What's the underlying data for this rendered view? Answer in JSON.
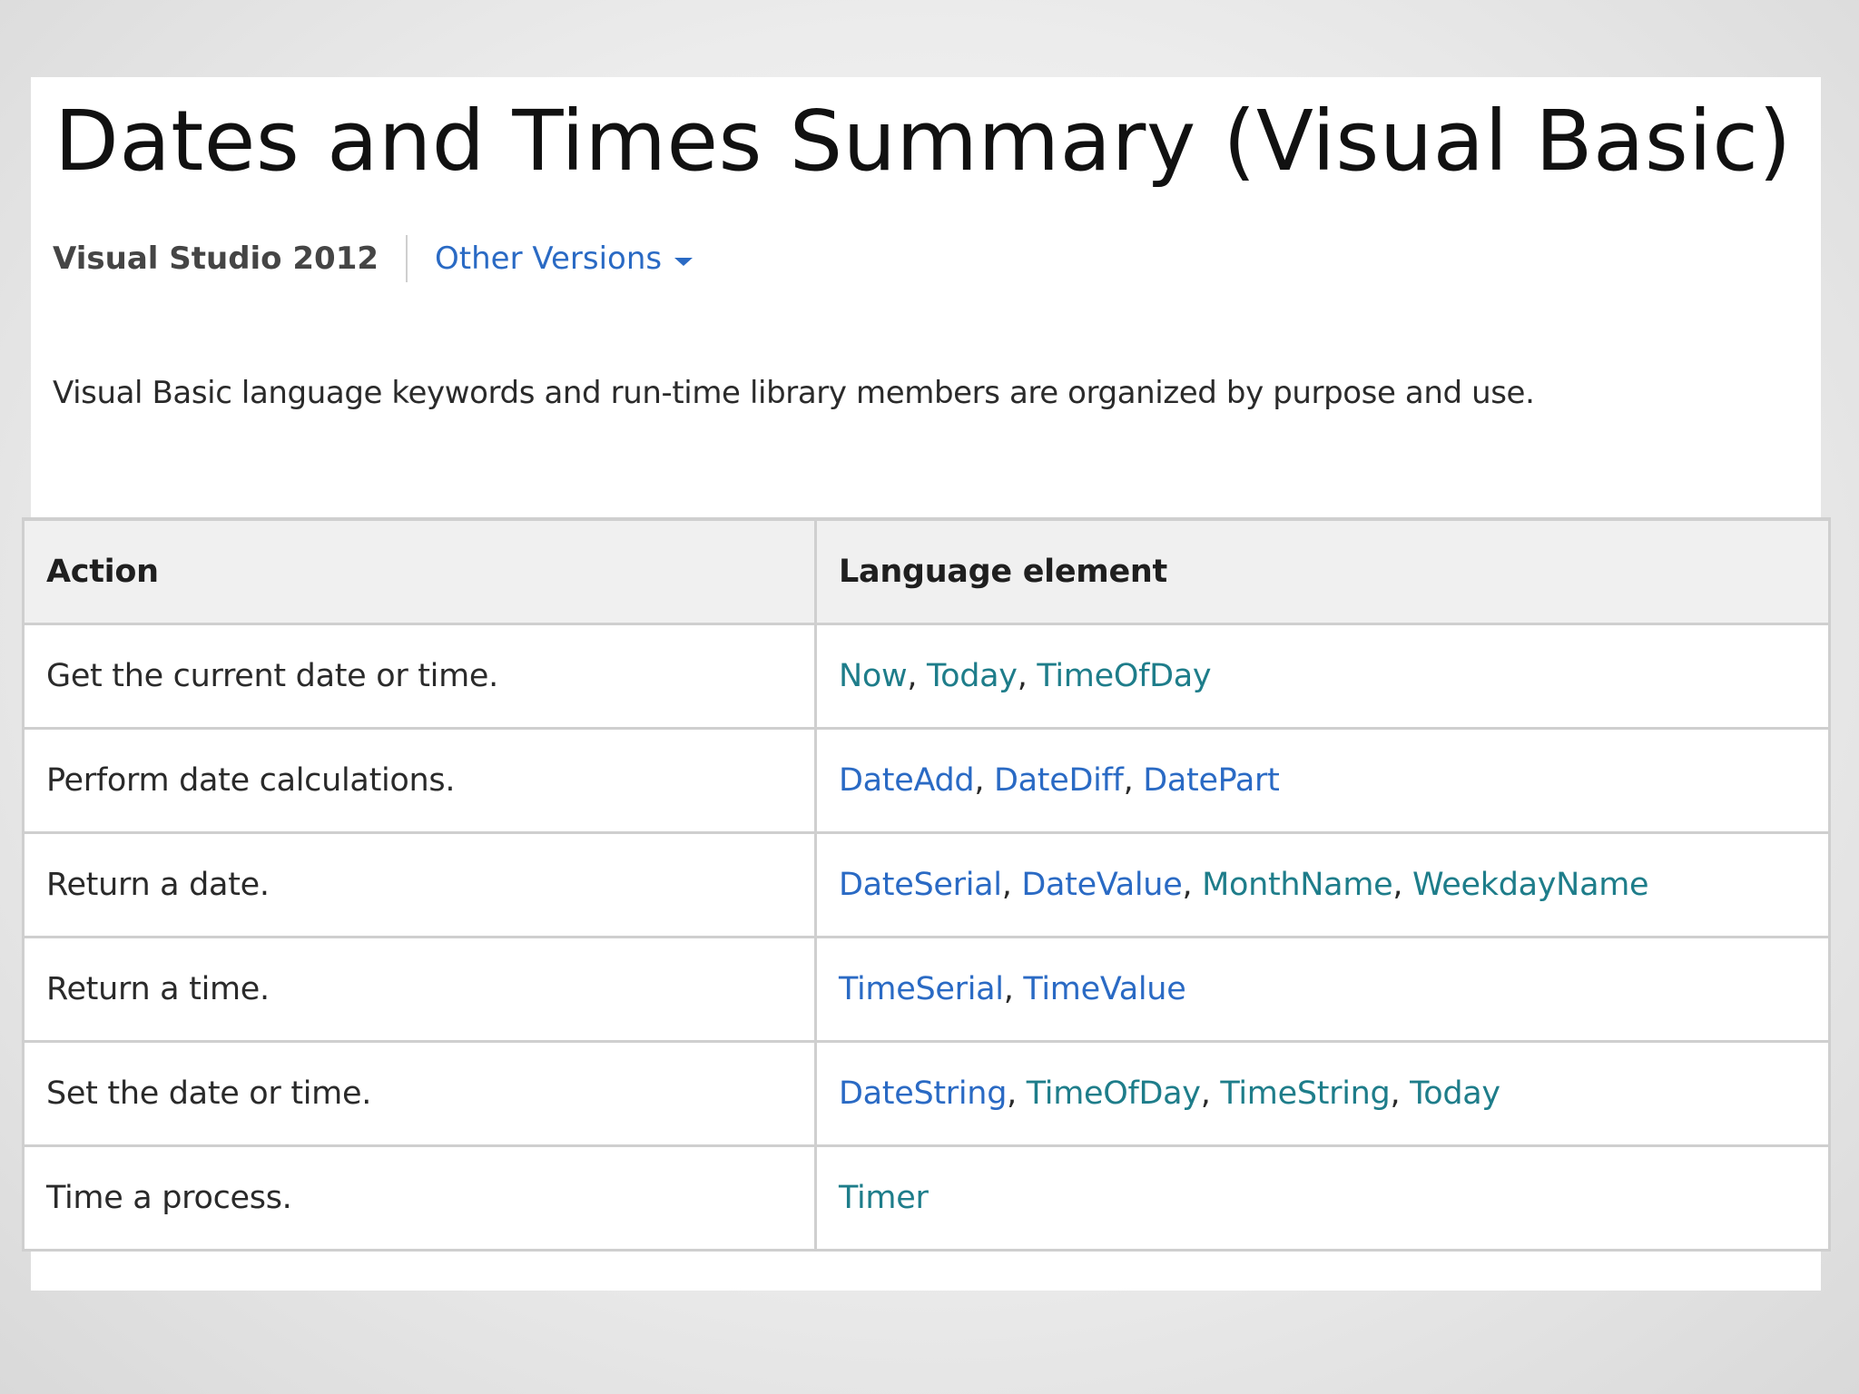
{
  "page": {
    "title": "Dates and Times Summary (Visual Basic)",
    "product": "Visual Studio 2012",
    "other_versions_label": "Other Versions",
    "intro": "Visual Basic language keywords and run-time library members are organized by purpose and use."
  },
  "table": {
    "headers": {
      "action": "Action",
      "language_element": "Language element"
    },
    "rows": [
      {
        "action": "Get the current date or time.",
        "elements": [
          "Now",
          "Today",
          "TimeOfDay"
        ]
      },
      {
        "action": "Perform date calculations.",
        "elements": [
          "DateAdd",
          "DateDiff",
          "DatePart"
        ]
      },
      {
        "action": "Return a date.",
        "elements": [
          "DateSerial",
          "DateValue",
          "MonthName",
          "WeekdayName"
        ]
      },
      {
        "action": "Return a time.",
        "elements": [
          "TimeSerial",
          "TimeValue"
        ]
      },
      {
        "action": "Set the date or time.",
        "elements": [
          "DateString",
          "TimeOfDay",
          "TimeString",
          "Today"
        ]
      },
      {
        "action": "Time a process.",
        "elements": [
          "Timer"
        ]
      }
    ]
  },
  "colors": {
    "link": "#2a6ac4",
    "link_visited": "#1e7d8a",
    "highlight_border": "#d9131e"
  },
  "icons": {
    "other_versions_caret": "chevron-down-icon"
  }
}
